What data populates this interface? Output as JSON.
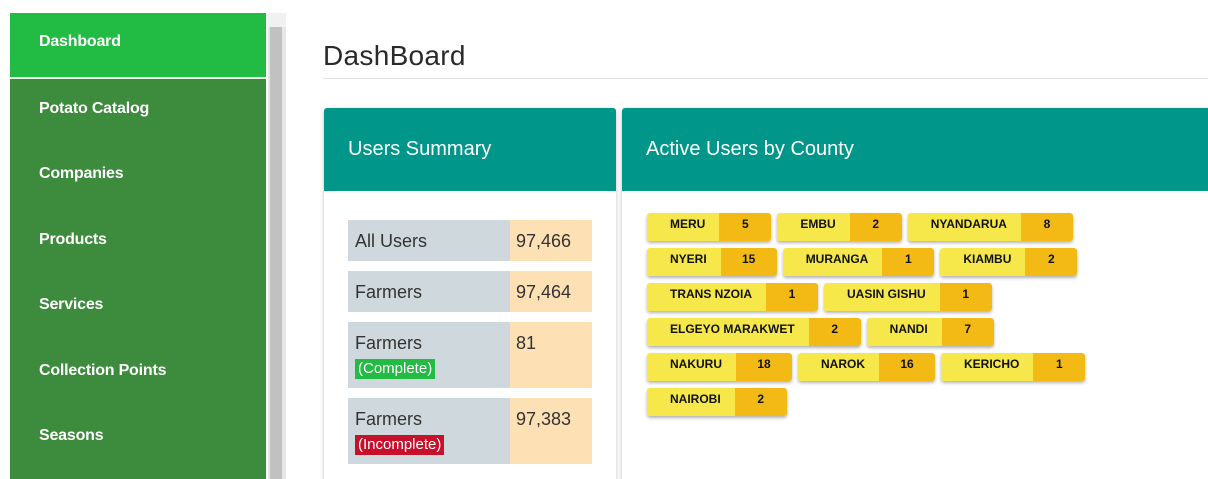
{
  "sidebar": {
    "items": [
      {
        "label": "Dashboard",
        "active": true
      },
      {
        "label": "Potato Catalog",
        "active": false
      },
      {
        "label": "Companies",
        "active": false
      },
      {
        "label": "Products",
        "active": false
      },
      {
        "label": "Services",
        "active": false
      },
      {
        "label": "Collection Points",
        "active": false
      },
      {
        "label": "Seasons",
        "active": false
      }
    ]
  },
  "page": {
    "title": "DashBoard"
  },
  "users_summary": {
    "title": "Users Summary",
    "rows": [
      {
        "label": "All Users",
        "tag": "",
        "value": "97,466"
      },
      {
        "label": "Farmers",
        "tag": "",
        "value": "97,464"
      },
      {
        "label": "Farmers",
        "tag": "(Complete)",
        "value": "81"
      },
      {
        "label": "Farmers",
        "tag": "(Incomplete)",
        "value": "97,383"
      }
    ]
  },
  "county": {
    "title": "Active Users by County",
    "rows": [
      [
        {
          "name": "MERU",
          "count": "5"
        },
        {
          "name": "EMBU",
          "count": "2"
        },
        {
          "name": "NYANDARUA",
          "count": "8"
        }
      ],
      [
        {
          "name": "NYERI",
          "count": "15"
        },
        {
          "name": "MURANGA",
          "count": "1"
        },
        {
          "name": "KIAMBU",
          "count": "2"
        }
      ],
      [
        {
          "name": "TRANS NZOIA",
          "count": "1"
        },
        {
          "name": "UASIN GISHU",
          "count": "1"
        }
      ],
      [
        {
          "name": "ELGEYO MARAKWET",
          "count": "2"
        },
        {
          "name": "NANDI",
          "count": "7"
        }
      ],
      [
        {
          "name": "NAKURU",
          "count": "18"
        },
        {
          "name": "NAROK",
          "count": "16"
        },
        {
          "name": "KERICHO",
          "count": "1"
        }
      ],
      [
        {
          "name": "NAIROBI",
          "count": "2"
        }
      ]
    ]
  },
  "colors": {
    "sidebar_bg": "#3d8b3d",
    "sidebar_active": "#22bb44",
    "card_header": "#00968a",
    "label_cell": "#cfd8dc",
    "value_cell": "#fde0b4",
    "tag_complete": "#22bb44",
    "tag_incomplete": "#c7102a",
    "pill_name": "#f6e74a",
    "pill_count": "#f3b914"
  }
}
